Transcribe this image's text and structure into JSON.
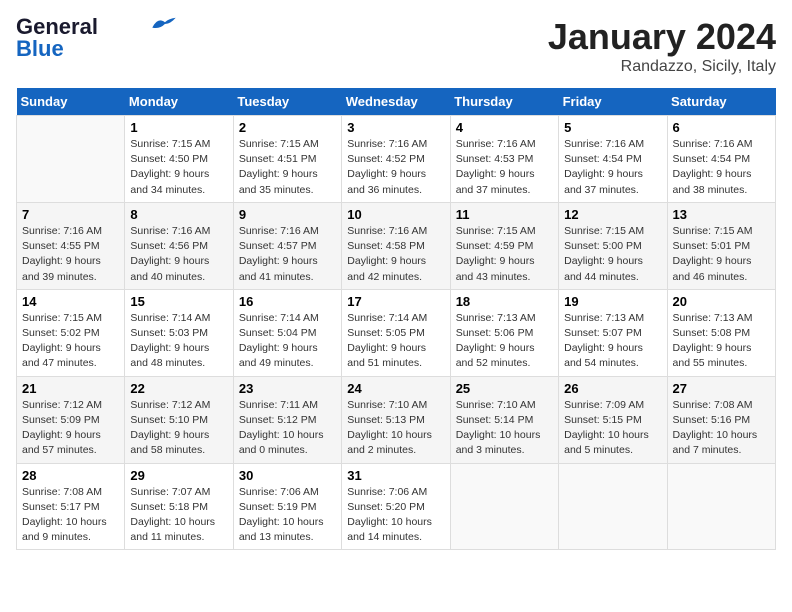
{
  "header": {
    "logo_line1": "General",
    "logo_line2": "Blue",
    "month": "January 2024",
    "location": "Randazzo, Sicily, Italy"
  },
  "weekdays": [
    "Sunday",
    "Monday",
    "Tuesday",
    "Wednesday",
    "Thursday",
    "Friday",
    "Saturday"
  ],
  "weeks": [
    [
      {
        "day": "",
        "info": ""
      },
      {
        "day": "1",
        "info": "Sunrise: 7:15 AM\nSunset: 4:50 PM\nDaylight: 9 hours\nand 34 minutes."
      },
      {
        "day": "2",
        "info": "Sunrise: 7:15 AM\nSunset: 4:51 PM\nDaylight: 9 hours\nand 35 minutes."
      },
      {
        "day": "3",
        "info": "Sunrise: 7:16 AM\nSunset: 4:52 PM\nDaylight: 9 hours\nand 36 minutes."
      },
      {
        "day": "4",
        "info": "Sunrise: 7:16 AM\nSunset: 4:53 PM\nDaylight: 9 hours\nand 37 minutes."
      },
      {
        "day": "5",
        "info": "Sunrise: 7:16 AM\nSunset: 4:54 PM\nDaylight: 9 hours\nand 37 minutes."
      },
      {
        "day": "6",
        "info": "Sunrise: 7:16 AM\nSunset: 4:54 PM\nDaylight: 9 hours\nand 38 minutes."
      }
    ],
    [
      {
        "day": "7",
        "info": "Sunrise: 7:16 AM\nSunset: 4:55 PM\nDaylight: 9 hours\nand 39 minutes."
      },
      {
        "day": "8",
        "info": "Sunrise: 7:16 AM\nSunset: 4:56 PM\nDaylight: 9 hours\nand 40 minutes."
      },
      {
        "day": "9",
        "info": "Sunrise: 7:16 AM\nSunset: 4:57 PM\nDaylight: 9 hours\nand 41 minutes."
      },
      {
        "day": "10",
        "info": "Sunrise: 7:16 AM\nSunset: 4:58 PM\nDaylight: 9 hours\nand 42 minutes."
      },
      {
        "day": "11",
        "info": "Sunrise: 7:15 AM\nSunset: 4:59 PM\nDaylight: 9 hours\nand 43 minutes."
      },
      {
        "day": "12",
        "info": "Sunrise: 7:15 AM\nSunset: 5:00 PM\nDaylight: 9 hours\nand 44 minutes."
      },
      {
        "day": "13",
        "info": "Sunrise: 7:15 AM\nSunset: 5:01 PM\nDaylight: 9 hours\nand 46 minutes."
      }
    ],
    [
      {
        "day": "14",
        "info": "Sunrise: 7:15 AM\nSunset: 5:02 PM\nDaylight: 9 hours\nand 47 minutes."
      },
      {
        "day": "15",
        "info": "Sunrise: 7:14 AM\nSunset: 5:03 PM\nDaylight: 9 hours\nand 48 minutes."
      },
      {
        "day": "16",
        "info": "Sunrise: 7:14 AM\nSunset: 5:04 PM\nDaylight: 9 hours\nand 49 minutes."
      },
      {
        "day": "17",
        "info": "Sunrise: 7:14 AM\nSunset: 5:05 PM\nDaylight: 9 hours\nand 51 minutes."
      },
      {
        "day": "18",
        "info": "Sunrise: 7:13 AM\nSunset: 5:06 PM\nDaylight: 9 hours\nand 52 minutes."
      },
      {
        "day": "19",
        "info": "Sunrise: 7:13 AM\nSunset: 5:07 PM\nDaylight: 9 hours\nand 54 minutes."
      },
      {
        "day": "20",
        "info": "Sunrise: 7:13 AM\nSunset: 5:08 PM\nDaylight: 9 hours\nand 55 minutes."
      }
    ],
    [
      {
        "day": "21",
        "info": "Sunrise: 7:12 AM\nSunset: 5:09 PM\nDaylight: 9 hours\nand 57 minutes."
      },
      {
        "day": "22",
        "info": "Sunrise: 7:12 AM\nSunset: 5:10 PM\nDaylight: 9 hours\nand 58 minutes."
      },
      {
        "day": "23",
        "info": "Sunrise: 7:11 AM\nSunset: 5:12 PM\nDaylight: 10 hours\nand 0 minutes."
      },
      {
        "day": "24",
        "info": "Sunrise: 7:10 AM\nSunset: 5:13 PM\nDaylight: 10 hours\nand 2 minutes."
      },
      {
        "day": "25",
        "info": "Sunrise: 7:10 AM\nSunset: 5:14 PM\nDaylight: 10 hours\nand 3 minutes."
      },
      {
        "day": "26",
        "info": "Sunrise: 7:09 AM\nSunset: 5:15 PM\nDaylight: 10 hours\nand 5 minutes."
      },
      {
        "day": "27",
        "info": "Sunrise: 7:08 AM\nSunset: 5:16 PM\nDaylight: 10 hours\nand 7 minutes."
      }
    ],
    [
      {
        "day": "28",
        "info": "Sunrise: 7:08 AM\nSunset: 5:17 PM\nDaylight: 10 hours\nand 9 minutes."
      },
      {
        "day": "29",
        "info": "Sunrise: 7:07 AM\nSunset: 5:18 PM\nDaylight: 10 hours\nand 11 minutes."
      },
      {
        "day": "30",
        "info": "Sunrise: 7:06 AM\nSunset: 5:19 PM\nDaylight: 10 hours\nand 13 minutes."
      },
      {
        "day": "31",
        "info": "Sunrise: 7:06 AM\nSunset: 5:20 PM\nDaylight: 10 hours\nand 14 minutes."
      },
      {
        "day": "",
        "info": ""
      },
      {
        "day": "",
        "info": ""
      },
      {
        "day": "",
        "info": ""
      }
    ]
  ]
}
